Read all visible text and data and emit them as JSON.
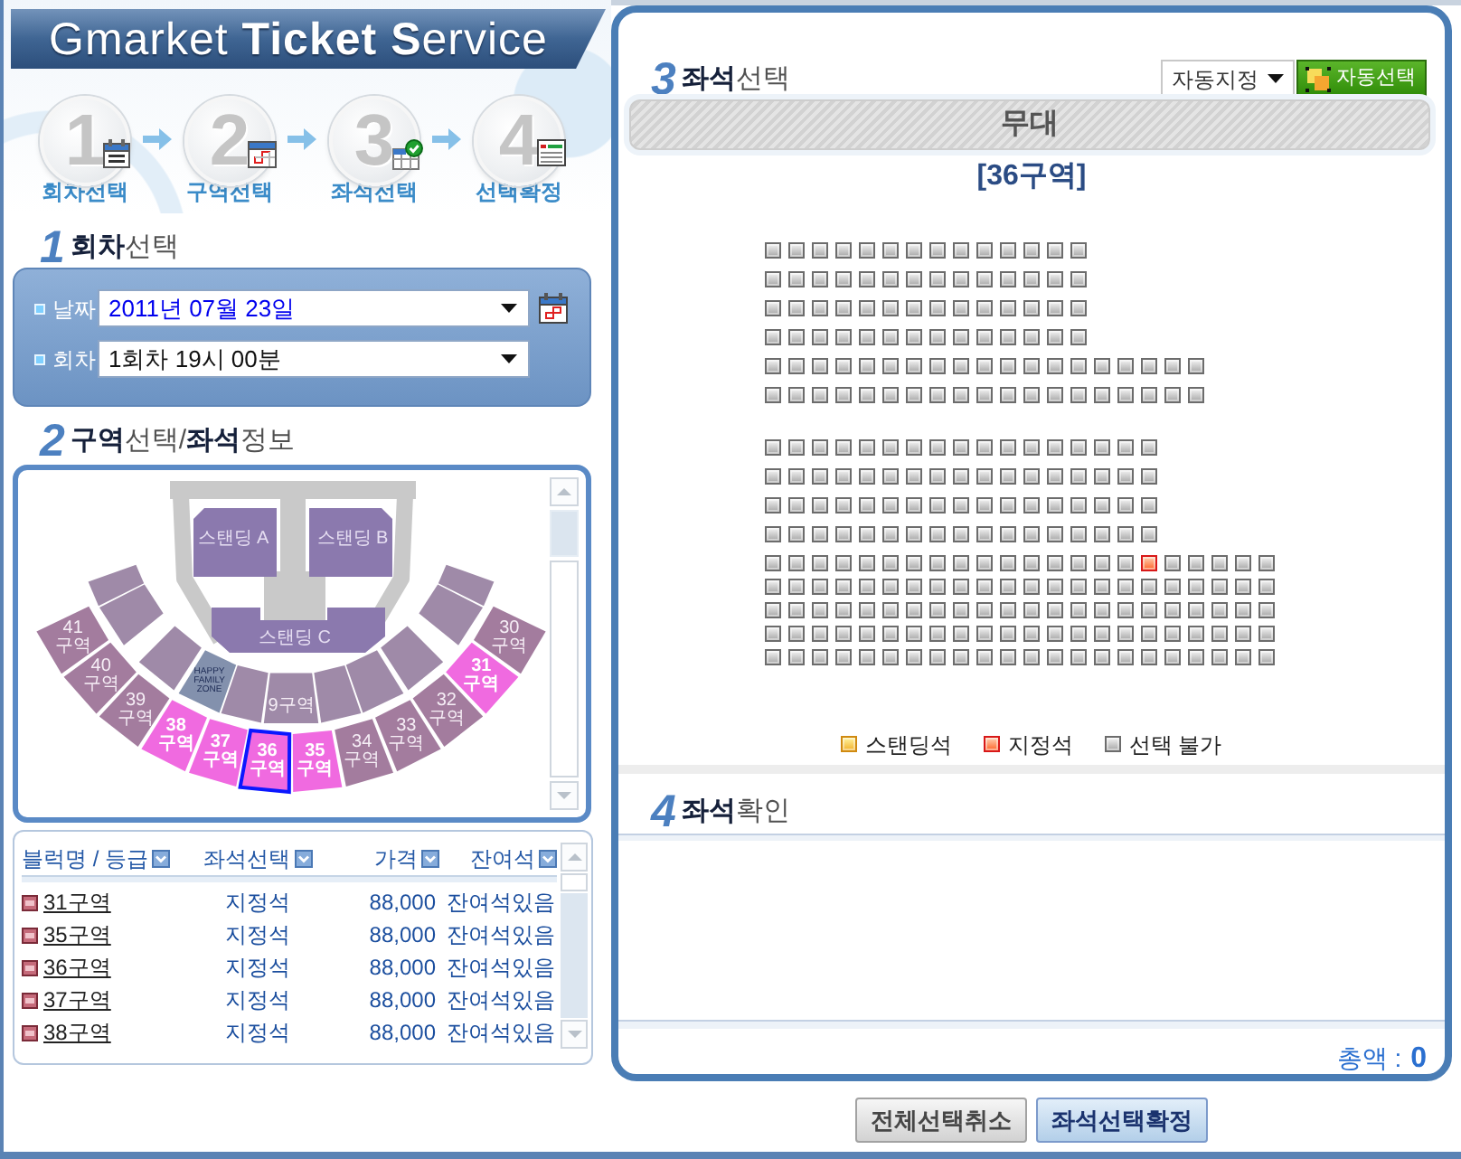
{
  "header": {
    "title": "Gmarket **Ticket** **S**ervice"
  },
  "steps": [
    {
      "number": "1",
      "label": "회차선택"
    },
    {
      "number": "2",
      "label": "구역선택"
    },
    {
      "number": "3",
      "label": "좌석선택"
    },
    {
      "number": "4",
      "label": "선택확정"
    }
  ],
  "schedule": {
    "number": "1",
    "title": "**회차**선택",
    "fields": [
      {
        "label": "날짜",
        "value": "2011년 07월 23일"
      },
      {
        "label": "회차",
        "value": "1회차 19시 00분"
      }
    ]
  },
  "zone_info": {
    "number": "2",
    "title": "**구역**선택/**좌석**정보",
    "section_map": {
      "standing_areas": [
        {
          "label": "스탠딩 A"
        },
        {
          "label": "스탠딩 B"
        },
        {
          "label": "스탠딩 C"
        }
      ],
      "inner_sections": [
        {
          "kind": "section",
          "available": false,
          "selected": false
        },
        {
          "kind": "section",
          "available": false,
          "selected": false
        },
        {
          "kind": "section",
          "available": false,
          "selected": false
        },
        {
          "kind": "zone",
          "label": "HAPPY FAMILY ZONE",
          "available": false,
          "selected": false
        },
        {
          "kind": "section",
          "available": false,
          "selected": false
        },
        {
          "kind": "section",
          "label": "9구역",
          "available": false,
          "selected": false
        },
        {
          "kind": "section",
          "available": false,
          "selected": false
        },
        {
          "kind": "section",
          "available": false,
          "selected": false
        },
        {
          "kind": "section",
          "available": false,
          "selected": false
        },
        {
          "kind": "section",
          "available": false,
          "selected": false
        },
        {
          "kind": "section",
          "available": false,
          "selected": false
        }
      ],
      "outer_sections": [
        {
          "label": "41구역",
          "available": false,
          "selected": false
        },
        {
          "label": "40구역",
          "available": false,
          "selected": false
        },
        {
          "label": "39구역",
          "available": false,
          "selected": false
        },
        {
          "label": "38구역",
          "available": true,
          "selected": false
        },
        {
          "label": "37구역",
          "available": true,
          "selected": false
        },
        {
          "label": "36구역",
          "available": true,
          "selected": true
        },
        {
          "label": "35구역",
          "available": true,
          "selected": false
        },
        {
          "label": "34구역",
          "available": false,
          "selected": false
        },
        {
          "label": "33구역",
          "available": false,
          "selected": false
        },
        {
          "label": "32구역",
          "available": false,
          "selected": false
        },
        {
          "label": "31구역",
          "available": true,
          "selected": false
        },
        {
          "label": "30구역",
          "available": false,
          "selected": false
        }
      ]
    },
    "table": {
      "columns": [
        "블럭명 / 등급",
        "좌석선택",
        "가격",
        "잔여석"
      ],
      "rows": [
        {
          "block": "31구역",
          "grade": "지정석",
          "price": "88,000",
          "remaining": "잔여석있음"
        },
        {
          "block": "35구역",
          "grade": "지정석",
          "price": "88,000",
          "remaining": "잔여석있음"
        },
        {
          "block": "36구역",
          "grade": "지정석",
          "price": "88,000",
          "remaining": "잔여석있음"
        },
        {
          "block": "37구역",
          "grade": "지정석",
          "price": "88,000",
          "remaining": "잔여석있음"
        },
        {
          "block": "38구역",
          "grade": "지정석",
          "price": "88,000",
          "remaining": "잔여석있음"
        }
      ]
    }
  },
  "seat_selection": {
    "number": "3",
    "title": "**좌석**선택",
    "mode_select": "자동지정",
    "auto_button": "자동선택",
    "stage": "무대",
    "zone_title": "[36구역]",
    "seat_blocks": [
      {
        "rows": [
          {
            "seats": [
              {
                "kind": "blocked"
              },
              {
                "kind": "blocked"
              },
              {
                "kind": "blocked"
              },
              {
                "kind": "blocked"
              },
              {
                "kind": "blocked"
              },
              {
                "kind": "blocked"
              },
              {
                "kind": "blocked"
              },
              {
                "kind": "blocked"
              },
              {
                "kind": "blocked"
              },
              {
                "kind": "blocked"
              },
              {
                "kind": "blocked"
              },
              {
                "kind": "blocked"
              },
              {
                "kind": "blocked"
              },
              {
                "kind": "blocked"
              }
            ]
          },
          {
            "seats": [
              {
                "kind": "blocked"
              },
              {
                "kind": "blocked"
              },
              {
                "kind": "blocked"
              },
              {
                "kind": "blocked"
              },
              {
                "kind": "blocked"
              },
              {
                "kind": "blocked"
              },
              {
                "kind": "blocked"
              },
              {
                "kind": "blocked"
              },
              {
                "kind": "blocked"
              },
              {
                "kind": "blocked"
              },
              {
                "kind": "blocked"
              },
              {
                "kind": "blocked"
              },
              {
                "kind": "blocked"
              },
              {
                "kind": "blocked"
              }
            ]
          },
          {
            "seats": [
              {
                "kind": "blocked"
              },
              {
                "kind": "blocked"
              },
              {
                "kind": "blocked"
              },
              {
                "kind": "blocked"
              },
              {
                "kind": "blocked"
              },
              {
                "kind": "blocked"
              },
              {
                "kind": "blocked"
              },
              {
                "kind": "blocked"
              },
              {
                "kind": "blocked"
              },
              {
                "kind": "blocked"
              },
              {
                "kind": "blocked"
              },
              {
                "kind": "blocked"
              },
              {
                "kind": "blocked"
              },
              {
                "kind": "blocked"
              }
            ]
          },
          {
            "seats": [
              {
                "kind": "blocked"
              },
              {
                "kind": "blocked"
              },
              {
                "kind": "blocked"
              },
              {
                "kind": "blocked"
              },
              {
                "kind": "blocked"
              },
              {
                "kind": "blocked"
              },
              {
                "kind": "blocked"
              },
              {
                "kind": "blocked"
              },
              {
                "kind": "blocked"
              },
              {
                "kind": "blocked"
              },
              {
                "kind": "blocked"
              },
              {
                "kind": "blocked"
              },
              {
                "kind": "blocked"
              },
              {
                "kind": "blocked"
              }
            ]
          },
          {
            "seats": [
              {
                "kind": "blocked"
              },
              {
                "kind": "blocked"
              },
              {
                "kind": "blocked"
              },
              {
                "kind": "blocked"
              },
              {
                "kind": "blocked"
              },
              {
                "kind": "blocked"
              },
              {
                "kind": "blocked"
              },
              {
                "kind": "blocked"
              },
              {
                "kind": "blocked"
              },
              {
                "kind": "blocked"
              },
              {
                "kind": "blocked"
              },
              {
                "kind": "blocked"
              },
              {
                "kind": "blocked"
              },
              {
                "kind": "blocked"
              },
              {
                "kind": "blocked"
              },
              {
                "kind": "blocked"
              },
              {
                "kind": "blocked"
              },
              {
                "kind": "blocked"
              },
              {
                "kind": "blocked"
              }
            ]
          },
          {
            "seats": [
              {
                "kind": "blocked"
              },
              {
                "kind": "blocked"
              },
              {
                "kind": "blocked"
              },
              {
                "kind": "blocked"
              },
              {
                "kind": "blocked"
              },
              {
                "kind": "blocked"
              },
              {
                "kind": "blocked"
              },
              {
                "kind": "blocked"
              },
              {
                "kind": "blocked"
              },
              {
                "kind": "blocked"
              },
              {
                "kind": "blocked"
              },
              {
                "kind": "blocked"
              },
              {
                "kind": "blocked"
              },
              {
                "kind": "blocked"
              },
              {
                "kind": "blocked"
              },
              {
                "kind": "blocked"
              },
              {
                "kind": "blocked"
              },
              {
                "kind": "blocked"
              },
              {
                "kind": "blocked"
              }
            ]
          }
        ]
      },
      {
        "rows": [
          {
            "seats": [
              {
                "kind": "blocked"
              },
              {
                "kind": "blocked"
              },
              {
                "kind": "blocked"
              },
              {
                "kind": "blocked"
              },
              {
                "kind": "blocked"
              },
              {
                "kind": "blocked"
              },
              {
                "kind": "blocked"
              },
              {
                "kind": "blocked"
              },
              {
                "kind": "blocked"
              },
              {
                "kind": "blocked"
              },
              {
                "kind": "blocked"
              },
              {
                "kind": "blocked"
              },
              {
                "kind": "blocked"
              },
              {
                "kind": "blocked"
              },
              {
                "kind": "blocked"
              },
              {
                "kind": "blocked"
              },
              {
                "kind": "blocked"
              }
            ]
          },
          {
            "seats": [
              {
                "kind": "blocked"
              },
              {
                "kind": "blocked"
              },
              {
                "kind": "blocked"
              },
              {
                "kind": "blocked"
              },
              {
                "kind": "blocked"
              },
              {
                "kind": "blocked"
              },
              {
                "kind": "blocked"
              },
              {
                "kind": "blocked"
              },
              {
                "kind": "blocked"
              },
              {
                "kind": "blocked"
              },
              {
                "kind": "blocked"
              },
              {
                "kind": "blocked"
              },
              {
                "kind": "blocked"
              },
              {
                "kind": "blocked"
              },
              {
                "kind": "blocked"
              },
              {
                "kind": "blocked"
              },
              {
                "kind": "blocked"
              }
            ]
          },
          {
            "seats": [
              {
                "kind": "blocked"
              },
              {
                "kind": "blocked"
              },
              {
                "kind": "blocked"
              },
              {
                "kind": "blocked"
              },
              {
                "kind": "blocked"
              },
              {
                "kind": "blocked"
              },
              {
                "kind": "blocked"
              },
              {
                "kind": "blocked"
              },
              {
                "kind": "blocked"
              },
              {
                "kind": "blocked"
              },
              {
                "kind": "blocked"
              },
              {
                "kind": "blocked"
              },
              {
                "kind": "blocked"
              },
              {
                "kind": "blocked"
              },
              {
                "kind": "blocked"
              },
              {
                "kind": "blocked"
              },
              {
                "kind": "blocked"
              }
            ]
          },
          {
            "seats": [
              {
                "kind": "blocked"
              },
              {
                "kind": "blocked"
              },
              {
                "kind": "blocked"
              },
              {
                "kind": "blocked"
              },
              {
                "kind": "blocked"
              },
              {
                "kind": "blocked"
              },
              {
                "kind": "blocked"
              },
              {
                "kind": "blocked"
              },
              {
                "kind": "blocked"
              },
              {
                "kind": "blocked"
              },
              {
                "kind": "blocked"
              },
              {
                "kind": "blocked"
              },
              {
                "kind": "blocked"
              },
              {
                "kind": "blocked"
              },
              {
                "kind": "blocked"
              },
              {
                "kind": "blocked"
              },
              {
                "kind": "blocked"
              }
            ]
          }
        ]
      },
      {
        "rows": [
          {
            "seats": [
              {
                "kind": "blocked"
              },
              {
                "kind": "blocked"
              },
              {
                "kind": "blocked"
              },
              {
                "kind": "blocked"
              },
              {
                "kind": "blocked"
              },
              {
                "kind": "blocked"
              },
              {
                "kind": "blocked"
              },
              {
                "kind": "blocked"
              },
              {
                "kind": "blocked"
              },
              {
                "kind": "blocked"
              },
              {
                "kind": "blocked"
              },
              {
                "kind": "blocked"
              },
              {
                "kind": "blocked"
              },
              {
                "kind": "blocked"
              },
              {
                "kind": "blocked"
              },
              {
                "kind": "blocked"
              },
              {
                "kind": "designated"
              },
              {
                "kind": "blocked"
              },
              {
                "kind": "blocked"
              },
              {
                "kind": "blocked"
              },
              {
                "kind": "blocked"
              },
              {
                "kind": "blocked"
              }
            ]
          },
          {
            "seats": [
              {
                "kind": "blocked"
              },
              {
                "kind": "blocked"
              },
              {
                "kind": "blocked"
              },
              {
                "kind": "blocked"
              },
              {
                "kind": "blocked"
              },
              {
                "kind": "blocked"
              },
              {
                "kind": "blocked"
              },
              {
                "kind": "blocked"
              },
              {
                "kind": "blocked"
              },
              {
                "kind": "blocked"
              },
              {
                "kind": "blocked"
              },
              {
                "kind": "blocked"
              },
              {
                "kind": "blocked"
              },
              {
                "kind": "blocked"
              },
              {
                "kind": "blocked"
              },
              {
                "kind": "blocked"
              },
              {
                "kind": "blocked"
              },
              {
                "kind": "blocked"
              },
              {
                "kind": "blocked"
              },
              {
                "kind": "blocked"
              },
              {
                "kind": "blocked"
              },
              {
                "kind": "blocked"
              }
            ]
          },
          {
            "seats": [
              {
                "kind": "blocked"
              },
              {
                "kind": "blocked"
              },
              {
                "kind": "blocked"
              },
              {
                "kind": "blocked"
              },
              {
                "kind": "blocked"
              },
              {
                "kind": "blocked"
              },
              {
                "kind": "blocked"
              },
              {
                "kind": "blocked"
              },
              {
                "kind": "blocked"
              },
              {
                "kind": "blocked"
              },
              {
                "kind": "blocked"
              },
              {
                "kind": "blocked"
              },
              {
                "kind": "blocked"
              },
              {
                "kind": "blocked"
              },
              {
                "kind": "blocked"
              },
              {
                "kind": "blocked"
              },
              {
                "kind": "blocked"
              },
              {
                "kind": "blocked"
              },
              {
                "kind": "blocked"
              },
              {
                "kind": "blocked"
              },
              {
                "kind": "blocked"
              },
              {
                "kind": "blocked"
              }
            ]
          },
          {
            "seats": [
              {
                "kind": "blocked"
              },
              {
                "kind": "blocked"
              },
              {
                "kind": "blocked"
              },
              {
                "kind": "blocked"
              },
              {
                "kind": "blocked"
              },
              {
                "kind": "blocked"
              },
              {
                "kind": "blocked"
              },
              {
                "kind": "blocked"
              },
              {
                "kind": "blocked"
              },
              {
                "kind": "blocked"
              },
              {
                "kind": "blocked"
              },
              {
                "kind": "blocked"
              },
              {
                "kind": "blocked"
              },
              {
                "kind": "blocked"
              },
              {
                "kind": "blocked"
              },
              {
                "kind": "blocked"
              },
              {
                "kind": "blocked"
              },
              {
                "kind": "blocked"
              },
              {
                "kind": "blocked"
              },
              {
                "kind": "blocked"
              },
              {
                "kind": "blocked"
              },
              {
                "kind": "blocked"
              }
            ]
          },
          {
            "seats": [
              {
                "kind": "blocked"
              },
              {
                "kind": "blocked"
              },
              {
                "kind": "blocked"
              },
              {
                "kind": "blocked"
              },
              {
                "kind": "blocked"
              },
              {
                "kind": "blocked"
              },
              {
                "kind": "blocked"
              },
              {
                "kind": "blocked"
              },
              {
                "kind": "blocked"
              },
              {
                "kind": "blocked"
              },
              {
                "kind": "blocked"
              },
              {
                "kind": "blocked"
              },
              {
                "kind": "blocked"
              },
              {
                "kind": "blocked"
              },
              {
                "kind": "blocked"
              },
              {
                "kind": "blocked"
              },
              {
                "kind": "blocked"
              },
              {
                "kind": "blocked"
              },
              {
                "kind": "blocked"
              },
              {
                "kind": "blocked"
              },
              {
                "kind": "blocked"
              },
              {
                "kind": "blocked"
              }
            ]
          }
        ]
      }
    ],
    "legend": [
      {
        "label": "스탠딩석",
        "kind": "standing"
      },
      {
        "label": "지정석",
        "kind": "designated"
      },
      {
        "label": "선택 불가",
        "kind": "blocked"
      }
    ]
  },
  "confirmation": {
    "number": "4",
    "title": "**좌석**확인",
    "total": {
      "label": "총액 :",
      "value": "0"
    }
  },
  "buttons": [
    {
      "label": "전체선택취소",
      "kind": "secondary"
    },
    {
      "label": "좌석선택확정",
      "kind": "primary"
    }
  ]
}
